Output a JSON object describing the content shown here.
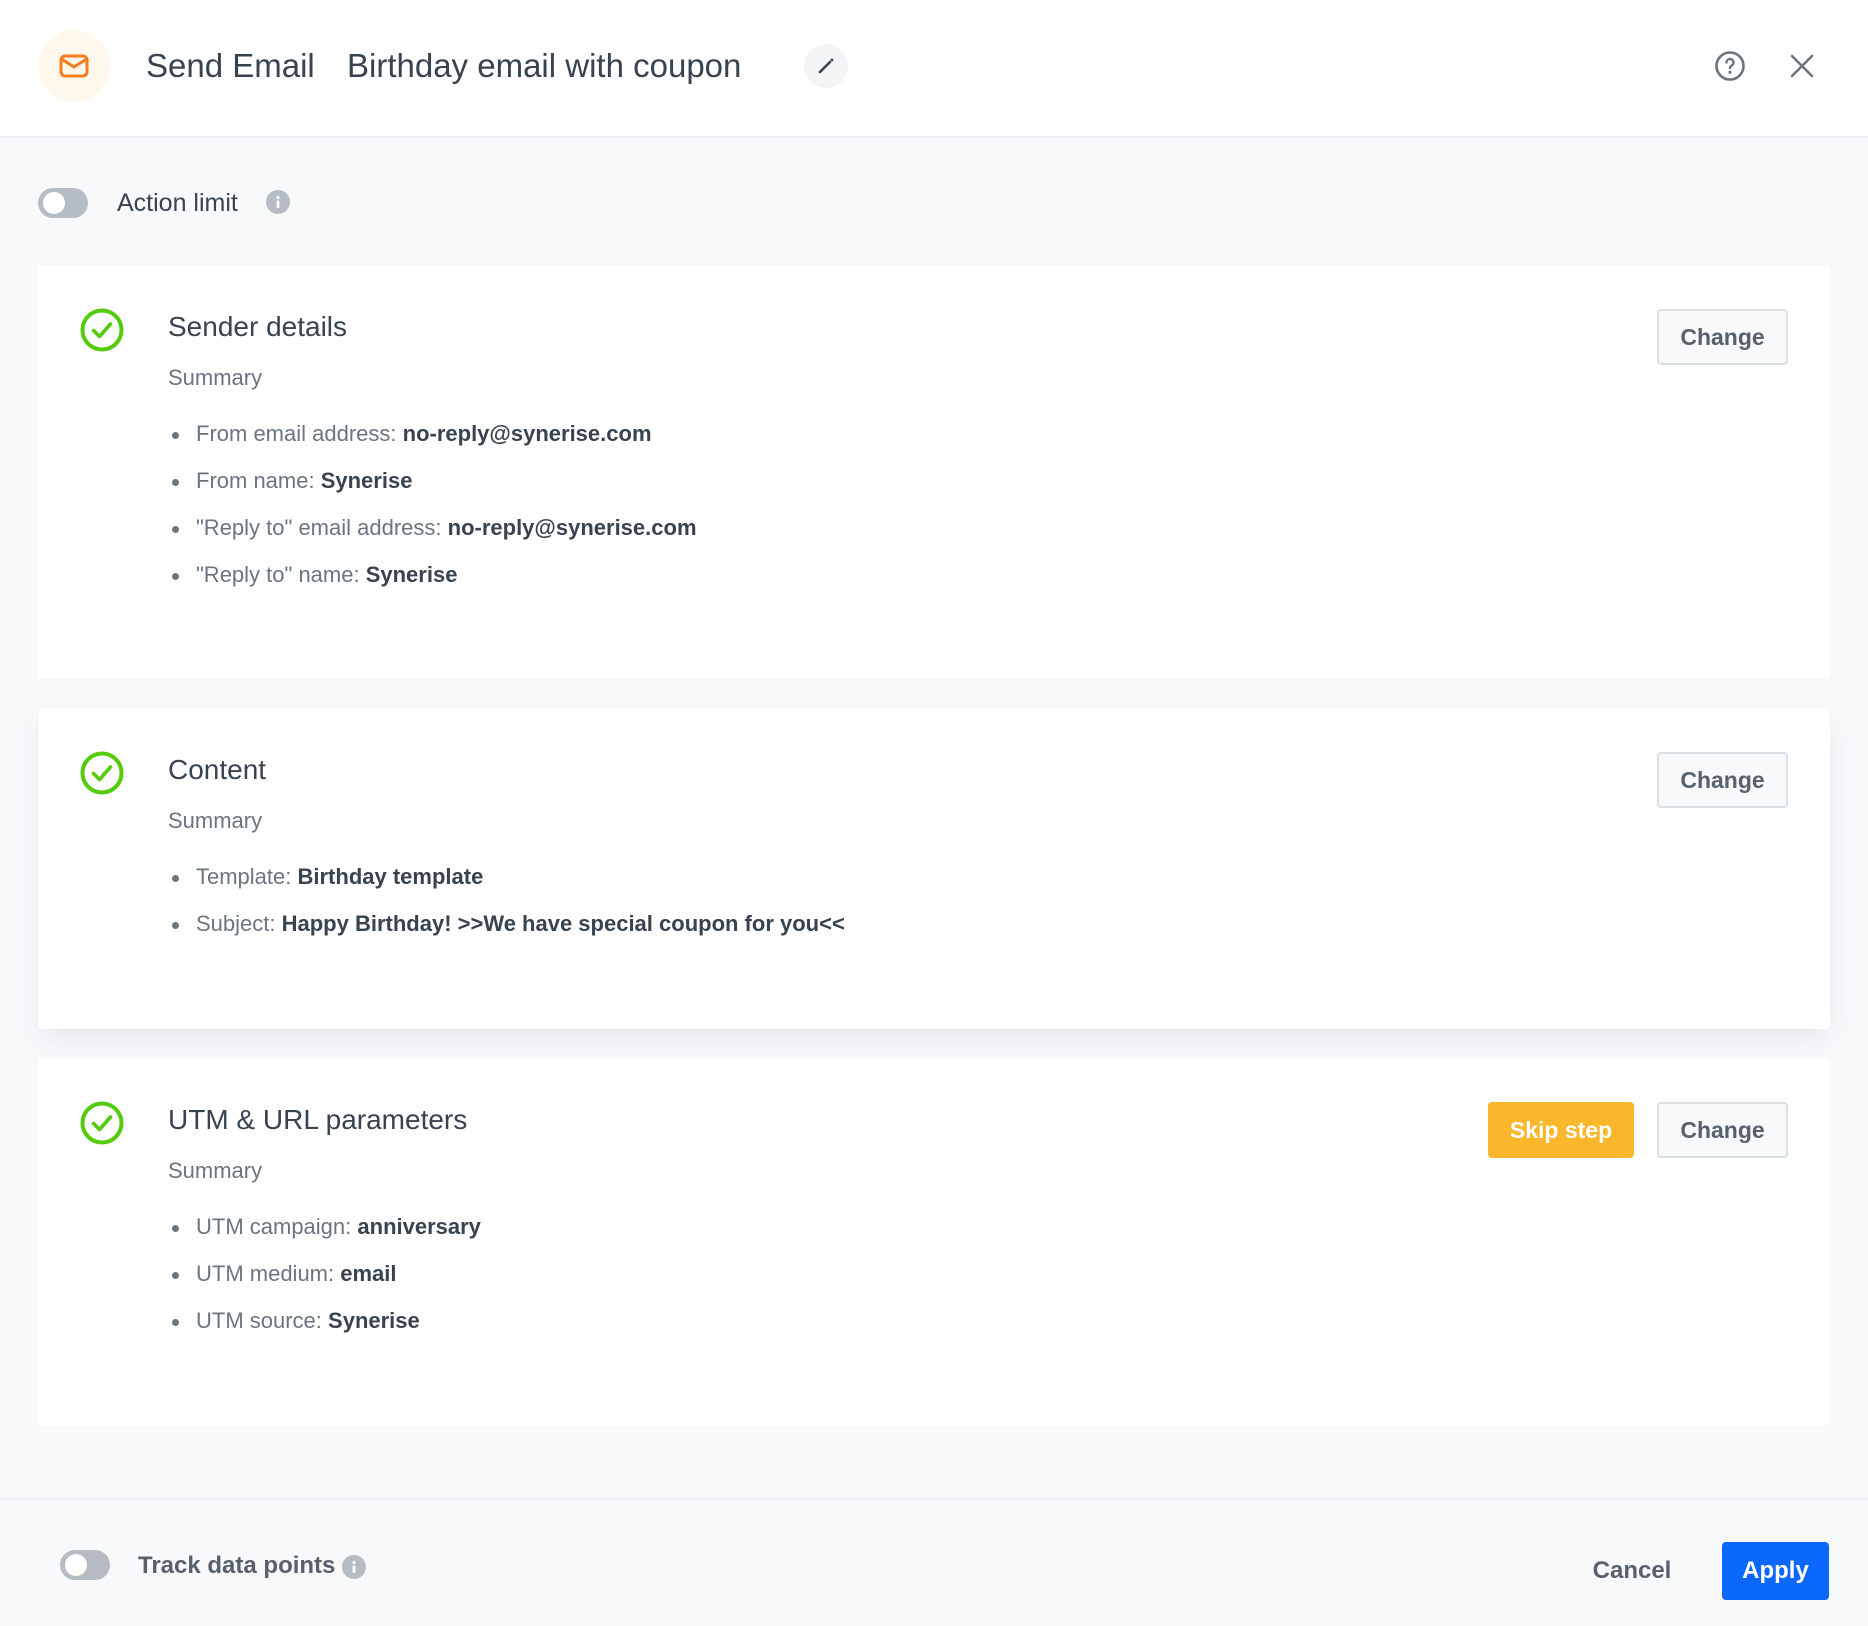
{
  "header": {
    "icon": "mail-icon",
    "action_type": "Send Email",
    "action_name": "Birthday email with coupon",
    "edit_icon": "pencil-icon",
    "help_icon": "help-circle-icon",
    "close_icon": "close-icon"
  },
  "action_limit": {
    "label": "Action limit",
    "enabled": false,
    "info_icon": "info-icon"
  },
  "cards": [
    {
      "title": "Sender details",
      "status": "complete",
      "summary_label": "Summary",
      "items": [
        {
          "label": "From email address: ",
          "value": "no-reply@synerise.com"
        },
        {
          "label": "From name: ",
          "value": "Synerise"
        },
        {
          "label": "\"Reply to\" email address: ",
          "value": "no-reply@synerise.com"
        },
        {
          "label": "\"Reply to\" name: ",
          "value": "Synerise"
        }
      ],
      "change_label": "Change"
    },
    {
      "title": "Content",
      "status": "complete",
      "summary_label": "Summary",
      "items": [
        {
          "label": "Template: ",
          "value": "Birthday template"
        },
        {
          "label": "Subject: ",
          "value": "Happy Birthday! >>We have special coupon for you<<"
        }
      ],
      "change_label": "Change"
    },
    {
      "title": "UTM & URL parameters",
      "status": "complete",
      "summary_label": "Summary",
      "items": [
        {
          "label": "UTM campaign: ",
          "value": "anniversary"
        },
        {
          "label": "UTM medium: ",
          "value": "email"
        },
        {
          "label": "UTM source: ",
          "value": "Synerise"
        }
      ],
      "skip_label": "Skip step",
      "change_label": "Change"
    }
  ],
  "footer": {
    "track_label": "Track data points",
    "track_enabled": false,
    "cancel_label": "Cancel",
    "apply_label": "Apply"
  },
  "colors": {
    "primary": "#0b68ff",
    "warning": "#fbb72b",
    "success": "#54cb0b",
    "mail_accent": "#f57c1f"
  }
}
